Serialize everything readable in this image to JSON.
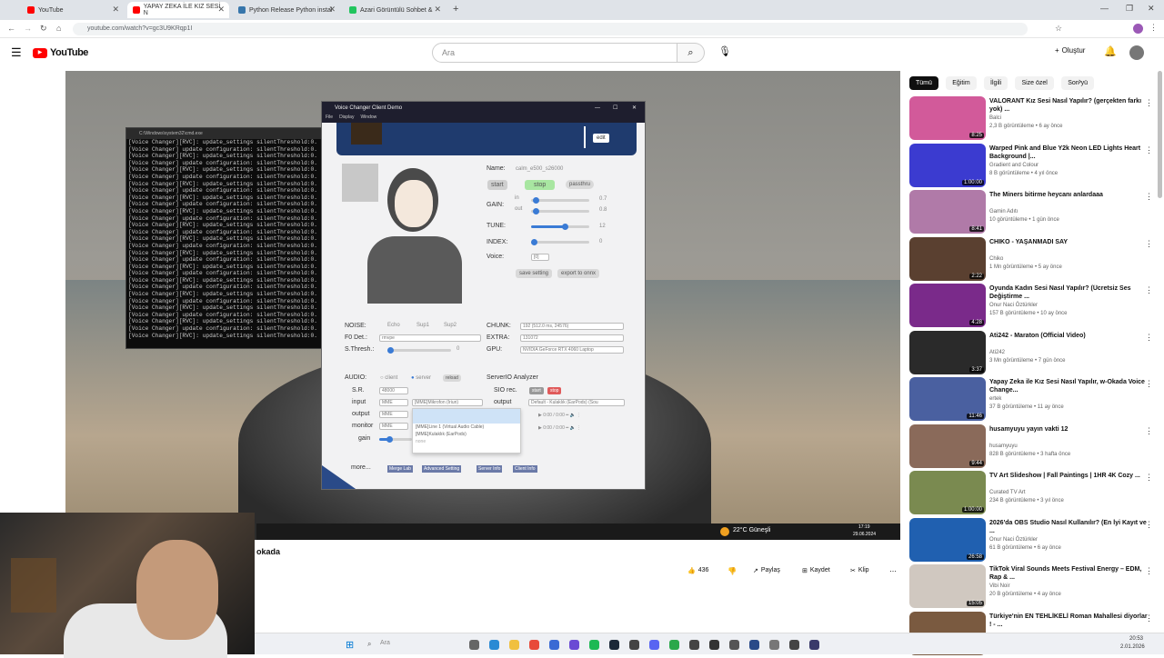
{
  "browser": {
    "tabs": [
      {
        "label": "YouTube",
        "color": "#ff0000"
      },
      {
        "label": "YAPAY ZEKA İLE KIZ SESİ N",
        "color": "#ff0000"
      },
      {
        "label": "Python Release Python instal",
        "color": "#3776ab"
      },
      {
        "label": "Azari Görüntülü Sohbet &",
        "color": "#22c55e"
      }
    ],
    "url": "youtube.com/watch?v=gc3U9KRqp1I"
  },
  "youtube": {
    "logo": "YouTube",
    "search_placeholder": "Ara",
    "create_label": "Oluştur",
    "video_title": "okada",
    "likes": "436",
    "share_label": "Paylaş",
    "save_label": "Kaydet",
    "clip_label": "Klip",
    "chips": [
      "Tümü",
      "Eğitim",
      "İlgili",
      "Size özel",
      "Son yü"
    ]
  },
  "cmd": {
    "title": "C:\\Windows\\system32\\cmd.exe",
    "lines": [
      "[Voice Changer][RVC]: update_settings silentThreshold:0.",
      "[Voice Changer] update configuration: silentThreshold:0.",
      "[Voice Changer][RVC]: update_settings silentThreshold:0.",
      "[Voice Changer] update configuration: silentThreshold:0.",
      "[Voice Changer][RVC]: update_settings silentThreshold:0.",
      "[Voice Changer] update configuration: silentThreshold:0.",
      "[Voice Changer][RVC]: update_settings silentThreshold:0.",
      "[Voice Changer] update configuration: silentThreshold:0.",
      "[Voice Changer][RVC]: update_settings silentThreshold:0.",
      "[Voice Changer] update configuration: silentThreshold:0.",
      "[Voice Changer][RVC]: update_settings silentThreshold:0.",
      "[Voice Changer] update configuration: silentThreshold:0.",
      "[Voice Changer][RVC]: update_settings silentThreshold:0.",
      "[Voice Changer] update configuration: silentThreshold:0.",
      "[Voice Changer][RVC]: update_settings silentThreshold:0.",
      "[Voice Changer] update configuration: silentThreshold:0.",
      "[Voice Changer][RVC]: update_settings silentThreshold:0.",
      "[Voice Changer] update configuration: silentThreshold:0.",
      "[Voice Changer][RVC]: update_settings silentThreshold:0.",
      "[Voice Changer] update configuration: silentThreshold:0.",
      "[Voice Changer][RVC]: update_settings silentThreshold:0.",
      "[Voice Changer] update configuration: silentThreshold:0.",
      "[Voice Changer][RVC]: update_settings silentThreshold:0.",
      "[Voice Changer] update configuration: silentThreshold:0.",
      "[Voice Changer][RVC]: update_settings silentThreshold:0.",
      "[Voice Changer] update configuration: silentThreshold:0.",
      "[Voice Changer][RVC]: update_settings silentThreshold:0.",
      "[Voice Changer] update configuration: silentThreshold:0.",
      "[Voice Changer][RVC]: update_settings silentThreshold:0."
    ]
  },
  "voice_changer": {
    "title": "Voice Changer Client Demo",
    "menu": [
      "File",
      "Display",
      "Window"
    ],
    "edit_label": "edit",
    "name_label": "Name:",
    "name_value": "calm_e500_s26000",
    "start_label": "start",
    "stop_label": "stop",
    "passthru_label": "passthru",
    "gain_label": "GAIN:",
    "in_label": "in",
    "out_label": "out",
    "gain_in": "0.7",
    "gain_out": "0.8",
    "tune_label": "TUNE:",
    "tune_value": "12",
    "index_label": "INDEX:",
    "index_value": "0",
    "voice_label": "Voice:",
    "voice_value": "[0]",
    "save_setting": "save setting",
    "export_onnx": "export to onnx",
    "noise_label": "NOISE:",
    "noise_options": [
      "Echo",
      "Sup1",
      "Sup2"
    ],
    "f0_label": "F0 Det.:",
    "f0_value": "rmvpe",
    "sthresh_label": "S.Thresh.:",
    "sthresh_value": "0",
    "chunk_label": "CHUNK:",
    "chunk_value": "192 (512.0 ms, 24576)",
    "extra_label": "EXTRA:",
    "extra_value": "131072",
    "gpu_label": "GPU:",
    "gpu_value": "NVIDIA GeForce RTX 4060 Laptop",
    "audio_label": "AUDIO:",
    "client_label": "client",
    "server_label": "server",
    "reload_label": "reload",
    "sr_label": "S.R.",
    "sr_value": "48000",
    "input_label": "input",
    "output_label": "output",
    "monitor_label": "monitor",
    "gain2_label": "gain",
    "mme": "MME",
    "input_device": "[MME]Mikrofon (Iriun)",
    "dropdown_options": [
      "[MME]Line 1 (Virtual Audio Cable)",
      "[MME]Kulaklık (EarPods)",
      "none"
    ],
    "analyzer_label": "ServerIO Analyzer",
    "sio_label": "SIO rec.",
    "sio_start": "start",
    "sio_stop": "stop",
    "output2_label": "output",
    "output_device": "Default - Kulaklık (EarPods) (Sou",
    "time1": "0:00 / 0:00",
    "time2": "0:00 / 0:00",
    "more_label": "more...",
    "more_buttons": [
      "Merge Lab",
      "Advanced Setting",
      "Server Info",
      "Client Info"
    ]
  },
  "video_taskbar": {
    "weather": "22°C Güneşli",
    "time": "17:19",
    "date": "29.06.2024"
  },
  "recommendations": [
    {
      "title": "VALORANT Kız Sesi Nasıl Yapılır? (gerçekten farkı yok) ...",
      "channel": "Balci",
      "meta": "2,3 B görüntüleme • 6 ay önce",
      "dur": "8:25",
      "color": "#d25a9a"
    },
    {
      "title": "Warped Pink and Blue Y2k Neon LED Lights Heart Background |...",
      "channel": "Gradient and Colour",
      "meta": "8 B görüntüleme • 4 yıl önce",
      "dur": "1:00:00",
      "color": "#3b3bd0"
    },
    {
      "title": "The Miners bitirme heycanı anlardaaa",
      "channel": "Gamin Adıtı",
      "meta": "10 görüntüleme • 1 gün önce",
      "dur": "8:41",
      "color": "#b07aa8"
    },
    {
      "title": "CHIKO - YAŞANMADI SAY",
      "channel": "Chiko",
      "meta": "1 Mn görüntüleme • 5 ay önce",
      "dur": "2:22",
      "color": "#5a4030"
    },
    {
      "title": "Oyunda Kadın Sesi Nasıl Yapılır? (Ücretsiz Ses Değiştirme ...",
      "channel": "Onur Naci Öztürkler",
      "meta": "157 B görüntüleme • 10 ay önce",
      "dur": "4:28",
      "color": "#7a2a8a"
    },
    {
      "title": "Ati242 - Maraton (Official Video)",
      "channel": "Ati242",
      "meta": "3 Mn görüntüleme • 7 gün önce",
      "dur": "3:37",
      "color": "#2a2a2a"
    },
    {
      "title": "Yapay Zeka ile Kız Sesi Nasıl Yapılır, w-Okada Voice Change...",
      "channel": "ertek",
      "meta": "37 B görüntüleme • 11 ay önce",
      "dur": "11:46",
      "color": "#4a60a0"
    },
    {
      "title": "husamyuyu yayın vakti 12",
      "channel": "husamyuyu",
      "meta": "828 B görüntüleme • 3 hafta önce",
      "dur": "9:44",
      "color": "#8a6a5a"
    },
    {
      "title": "TV Art Slideshow | Fall Paintings | 1HR 4K Cozy ...",
      "channel": "Curated TV Art",
      "meta": "234 B görüntüleme • 3 yıl önce",
      "dur": "1:00:00",
      "color": "#7a8a50"
    },
    {
      "title": "2026'da OBS Studio Nasıl Kullanılır? (En İyi Kayıt ve ...",
      "channel": "Onur Naci Öztürkler",
      "meta": "61 B görüntüleme • 6 ay önce",
      "dur": "26:58",
      "color": "#2060b0"
    },
    {
      "title": "TikTok Viral Sounds Meets Festival Energy – EDM, Rap & ...",
      "channel": "Vibi Noir",
      "meta": "20 B görüntüleme • 4 ay önce",
      "dur": "15:05",
      "color": "#d0c8c0"
    },
    {
      "title": "Türkiye'nin EN TEHLİKELİ Roman Mahallesi diyorlar ! - ...",
      "channel": "",
      "meta": "",
      "dur": "",
      "color": "#7a5a40"
    }
  ],
  "windows_taskbar": {
    "search": "Ara",
    "time": "20:53",
    "date": "2.01.2026"
  }
}
